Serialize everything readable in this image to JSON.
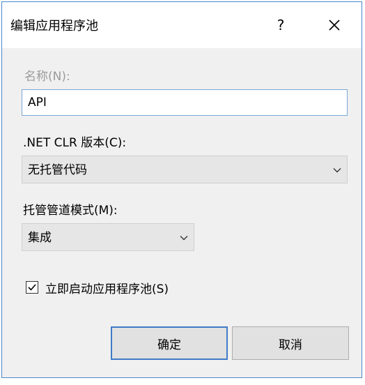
{
  "dialog": {
    "title": "编辑应用程序池",
    "help_label": "?"
  },
  "name_field": {
    "label": "名称(N):",
    "value": "API"
  },
  "clr_version": {
    "label": ".NET CLR 版本(C):",
    "selected": "无托管代码"
  },
  "pipeline_mode": {
    "label": "托管管道模式(M):",
    "selected": "集成"
  },
  "start_immediately": {
    "label": "立即启动应用程序池(S)",
    "checked": true
  },
  "buttons": {
    "ok": "确定",
    "cancel": "取消"
  }
}
